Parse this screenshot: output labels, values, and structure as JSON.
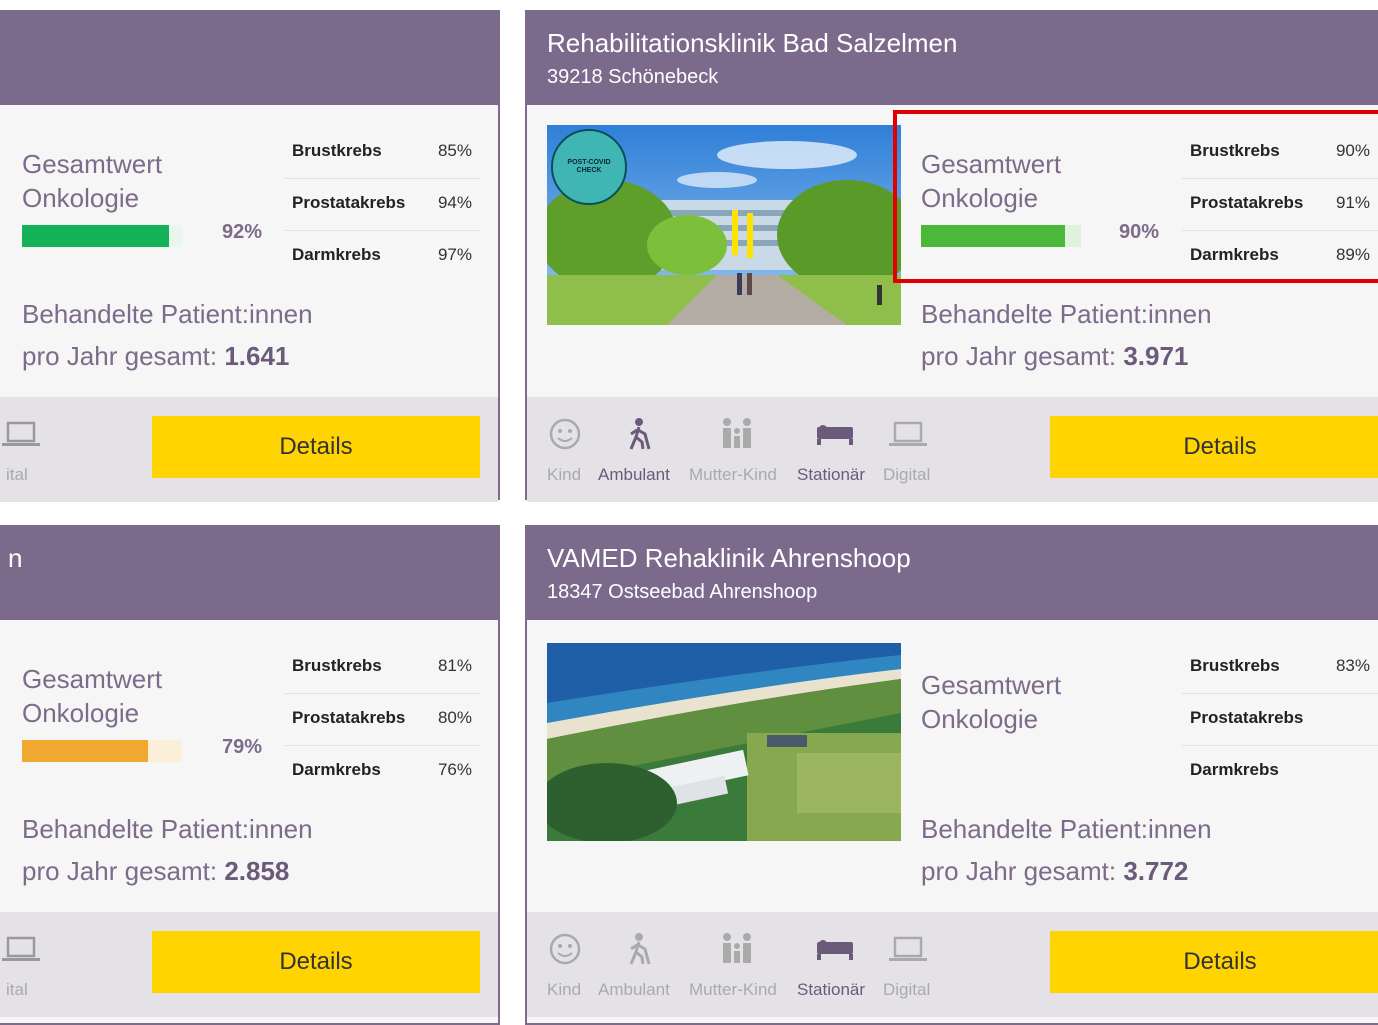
{
  "labels": {
    "gesamtwert_line1": "Gesamtwert",
    "gesamtwert_line2": "Onkologie",
    "behandelte_line1": "Behandelte Patient:innen",
    "behandelte_line2": "pro Jahr gesamt:",
    "details": "Details",
    "brust": "Brustkrebs",
    "prostata": "Prostatakrebs",
    "darm": "Darmkrebs",
    "kind": "Kind",
    "ambulant": "Ambulant",
    "mutter_kind": "Mutter-Kind",
    "stationaer": "Stationär",
    "digital": "Digital",
    "digital_partial": "ital",
    "title_partial": "n"
  },
  "colors": {
    "header": "#7b6a8b",
    "details_button": "#ffd400",
    "green": "#1db954",
    "lightgreen": "#4bb83a",
    "orange": "#f0a830",
    "highlight": "#e00000"
  },
  "cards": [
    {
      "position": "top-left",
      "title": "",
      "subtitle": "",
      "gesamtwert_percent": "92%",
      "gesamtwert_value": 0.92,
      "brust": "85%",
      "prostata": "94%",
      "darm": "97%",
      "patients": "1.641",
      "services_visible": [
        "digital"
      ]
    },
    {
      "position": "top-right",
      "title": "Rehabilitationsklinik Bad Salzelmen",
      "subtitle": "39218 Schönebeck",
      "gesamtwert_percent": "90%",
      "gesamtwert_value": 0.9,
      "brust": "90%",
      "prostata": "91%",
      "darm": "89%",
      "patients": "3.971",
      "badge_text": "POST-COVID CHECK",
      "services_active": [
        "ambulant",
        "stationaer"
      ],
      "highlighted": true
    },
    {
      "position": "bottom-left",
      "title": "n",
      "subtitle": "",
      "gesamtwert_percent": "79%",
      "gesamtwert_value": 0.79,
      "brust": "81%",
      "prostata": "80%",
      "darm": "76%",
      "patients": "2.858",
      "services_visible": [
        "digital"
      ]
    },
    {
      "position": "bottom-right",
      "title": "VAMED Rehaklinik Ahrenshoop",
      "subtitle": "18347 Ostseebad Ahrenshoop",
      "gesamtwert_percent": "",
      "brust": "83%",
      "prostata": "",
      "darm": "",
      "patients": "3.772",
      "services_active": [
        "stationaer"
      ]
    }
  ]
}
